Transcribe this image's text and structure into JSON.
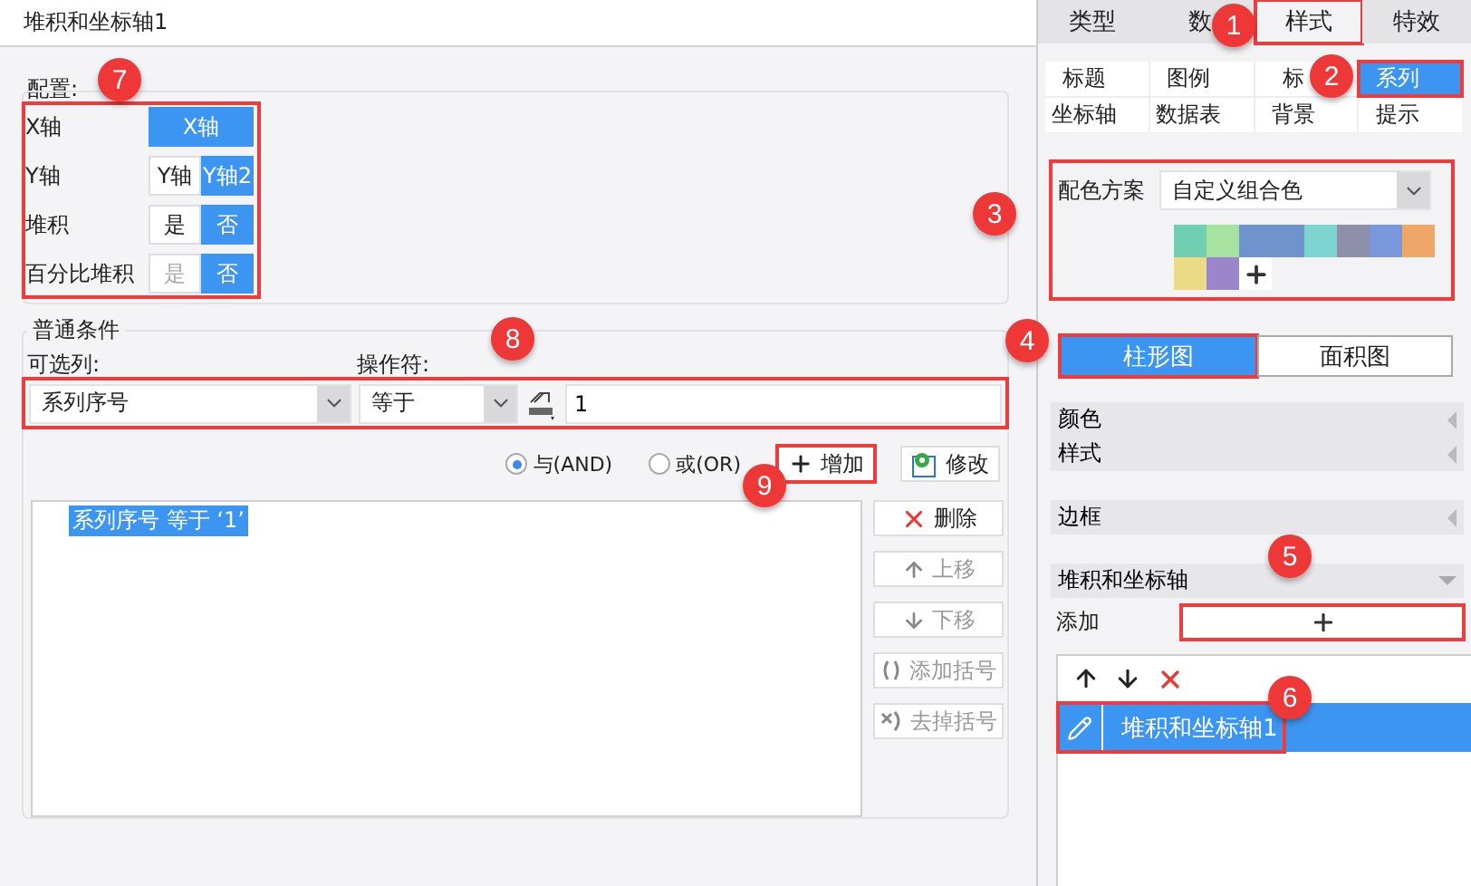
{
  "title": "堆积和坐标轴1",
  "config": {
    "legend": "配置:",
    "highlighted": true,
    "rows": [
      {
        "label": "X轴",
        "options": [
          {
            "label": "X轴",
            "selected": true,
            "disabled": false
          }
        ]
      },
      {
        "label": "Y轴",
        "options": [
          {
            "label": "Y轴",
            "selected": false,
            "disabled": false
          },
          {
            "label": "Y轴2",
            "selected": true,
            "disabled": false
          }
        ]
      },
      {
        "label": "堆积",
        "options": [
          {
            "label": "是",
            "selected": false,
            "disabled": false
          },
          {
            "label": "否",
            "selected": true,
            "disabled": false
          }
        ]
      },
      {
        "label": "百分比堆积",
        "options": [
          {
            "label": "是",
            "selected": false,
            "disabled": true
          },
          {
            "label": "否",
            "selected": true,
            "disabled": false
          }
        ]
      }
    ]
  },
  "condition": {
    "legend": "普通条件",
    "column_label": "可选列:",
    "operator_label": "操作符:",
    "inputs_highlighted": true,
    "column_value": "系列序号",
    "operator_value": "等于",
    "value": "1",
    "logic": [
      {
        "label": "与(AND)",
        "selected": true
      },
      {
        "label": "或(OR)",
        "selected": false
      }
    ],
    "add_button": {
      "label": "增加",
      "highlighted": true
    },
    "modify_button": {
      "label": "修改"
    },
    "conditions": [
      {
        "text": "系列序号 等于 ‘1’",
        "selected": true
      }
    ],
    "side_buttons": [
      {
        "kind": "delete",
        "label": "删除",
        "disabled": false
      },
      {
        "kind": "up",
        "label": "上移",
        "disabled": true
      },
      {
        "kind": "down",
        "label": "下移",
        "disabled": true
      },
      {
        "kind": "add-bracket",
        "label": "添加括号",
        "disabled": true
      },
      {
        "kind": "remove-bracket",
        "label": "去掉括号",
        "disabled": true
      }
    ]
  },
  "tabs": [
    {
      "label": "类型",
      "selected": false,
      "highlighted": false
    },
    {
      "label": "数",
      "selected": false,
      "highlighted": false
    },
    {
      "label": "样式",
      "selected": true,
      "highlighted": true
    },
    {
      "label": "特效",
      "selected": false,
      "highlighted": false
    }
  ],
  "subtabs": [
    {
      "label": "标题",
      "selected": false,
      "highlighted": false
    },
    {
      "label": "图例",
      "selected": false,
      "highlighted": false
    },
    {
      "label": "标",
      "selected": false,
      "highlighted": false
    },
    {
      "label": "系列",
      "selected": true,
      "highlighted": true
    },
    {
      "label": "坐标轴",
      "selected": false,
      "highlighted": false
    },
    {
      "label": "数据表",
      "selected": false,
      "highlighted": false
    },
    {
      "label": "背景",
      "selected": false,
      "highlighted": false
    },
    {
      "label": "提示",
      "selected": false,
      "highlighted": false
    }
  ],
  "color_scheme": {
    "label": "配色方案",
    "value": "自定义组合色",
    "highlighted": true,
    "swatches": [
      {
        "color": "#6fcfb0"
      },
      {
        "color": "#a6e2a0"
      },
      {
        "color": "#6f94cc"
      },
      {
        "color": "#6f94cc"
      },
      {
        "color": "#7ed5cf"
      },
      {
        "color": "#8e8fa8"
      },
      {
        "color": "#7b97dc"
      },
      {
        "color": "#eea767"
      },
      {
        "color": "#eadb84"
      },
      {
        "color": "#9b86cc"
      }
    ]
  },
  "chart_types": [
    {
      "label": "柱形图",
      "selected": true,
      "highlighted": true
    },
    {
      "label": "面积图",
      "selected": false,
      "highlighted": false
    }
  ],
  "section_groups": [
    [
      {
        "label": "颜色",
        "expanded": false
      },
      {
        "label": "样式",
        "expanded": false
      }
    ],
    [
      {
        "label": "边框",
        "expanded": false
      }
    ],
    [
      {
        "label": "堆积和坐标轴",
        "expanded": true
      }
    ]
  ],
  "add": {
    "label": "添加",
    "highlighted": true
  },
  "items": [
    {
      "label": "堆积和坐标轴1",
      "selected": true,
      "highlighted": true
    }
  ],
  "annotations": [
    "1",
    "2",
    "3",
    "4",
    "5",
    "6",
    "7",
    "8",
    "9"
  ]
}
